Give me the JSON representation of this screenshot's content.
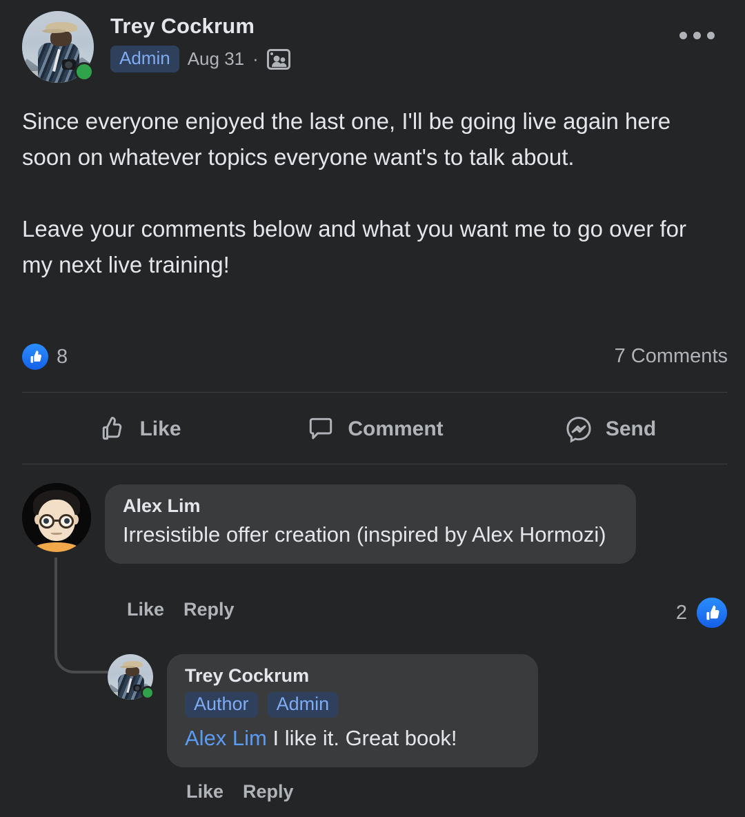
{
  "post": {
    "author": "Trey Cockrum",
    "badge": "Admin",
    "date": "Aug 31",
    "separator": "·",
    "audience_icon": "group-members-icon",
    "menu_icon": "more-options-icon",
    "body": "Since everyone enjoyed the last one, I'll be going live again here soon on whatever topics everyone want's to talk about.\n\nLeave your comments below and what you want me to go over for my next live training!",
    "reaction_icon": "like-reaction-icon",
    "reaction_count": "8",
    "comments_count": "7 Comments"
  },
  "actions": [
    {
      "label": "Like",
      "icon": "thumbs-up-outline-icon"
    },
    {
      "label": "Comment",
      "icon": "speech-bubble-icon"
    },
    {
      "label": "Send",
      "icon": "messenger-icon"
    }
  ],
  "comments": [
    {
      "author": "Alex Lim",
      "avatar_icon": "cartoon-avatar-icon",
      "text": "Irresistible offer creation (inspired by Alex Hormozi)",
      "like_label": "Like",
      "reply_label": "Reply",
      "like_count": "2",
      "like_icon": "like-reaction-icon"
    }
  ],
  "reply": {
    "author": "Trey Cockrum",
    "avatar_icon": "photo-avatar-icon",
    "badges": [
      "Author",
      "Admin"
    ],
    "mention": "Alex Lim",
    "text": " I like it. Great book!",
    "like_label": "Like",
    "reply_label": "Reply"
  },
  "colors": {
    "page_bg": "#242526",
    "bubble_bg": "#3a3b3c",
    "badge_bg": "#2f405c",
    "badge_text": "#7fabf2",
    "accent_blue": "#1877f2",
    "online_green": "#31a24c",
    "primary_text": "#e4e6eb",
    "secondary_text": "#b0b3b8",
    "divider": "#3e4042"
  }
}
